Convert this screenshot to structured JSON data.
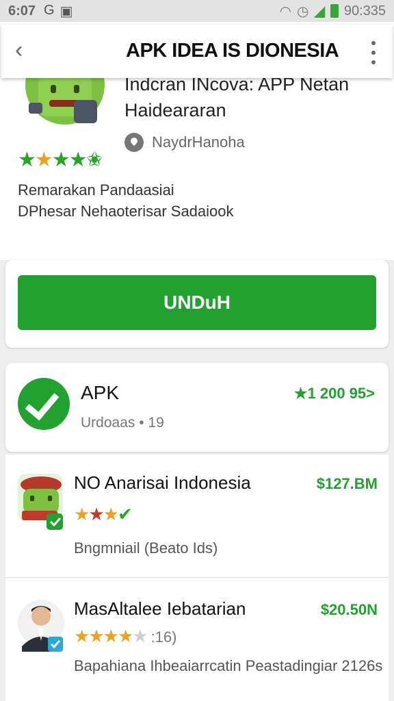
{
  "status_bar": {
    "time": "6:07",
    "clock": "90:335"
  },
  "app_bar": {
    "title": "APK IDEA IS DIONESIA"
  },
  "app_info": {
    "subtitle": "Indcran INcova: APP Netan Haideararan",
    "developer": "NaydrHanoha",
    "rating_stars": 5,
    "description": "Remarakan Pandaasiai DPhesar Nehaoterisar Sadaiook"
  },
  "download": {
    "label": "UNDuH"
  },
  "apk_card": {
    "title": "APK",
    "meta": "Urdoaas • 19",
    "rating": "★1 200 95>"
  },
  "list": [
    {
      "title": "NO Anarisai Indonesia",
      "price": "$127.BM",
      "subtitle": "Bngmniail (Beato Ids)"
    },
    {
      "title": "MasAltalee Iebatarian",
      "price": "$20.50N",
      "rating_count": ":16)",
      "subtitle": "Bapahiana Ihbeaiarrcatin Peastadingiar 2126s"
    }
  ],
  "colors": {
    "accent_green": "#22a030",
    "star_gold": "#e9a322"
  }
}
